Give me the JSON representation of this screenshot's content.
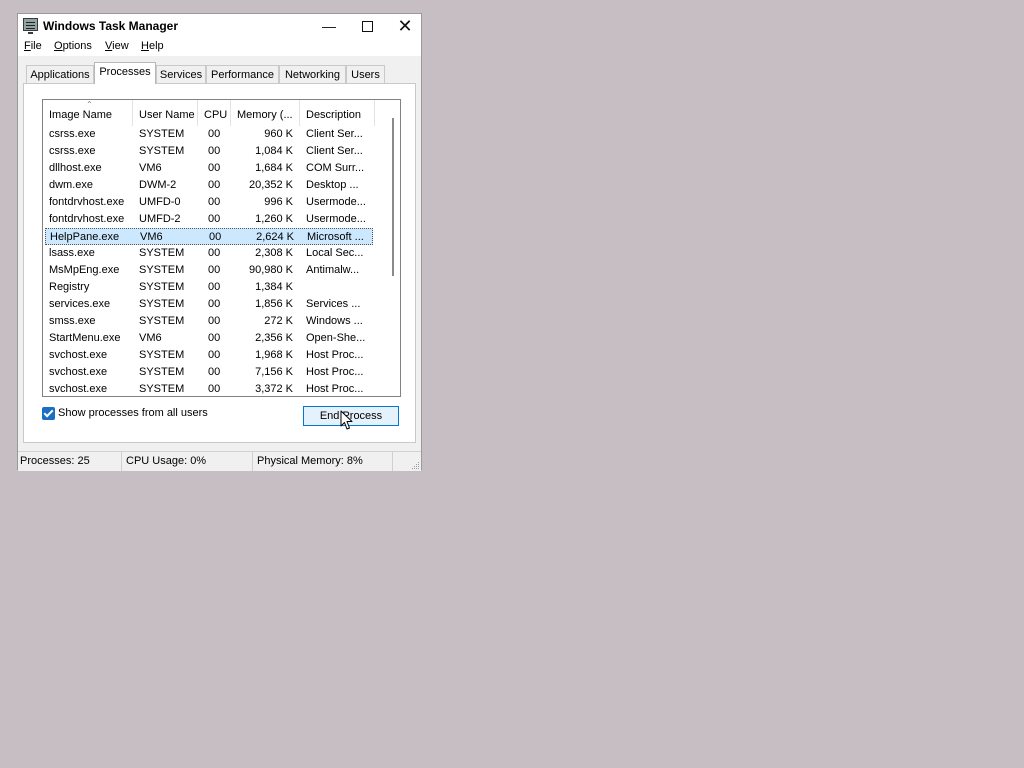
{
  "window": {
    "title": "Windows Task Manager"
  },
  "menu": [
    {
      "label": "File",
      "accel": "F",
      "rest": "ile"
    },
    {
      "label": "Options",
      "accel": "O",
      "rest": "ptions"
    },
    {
      "label": "View",
      "accel": "V",
      "rest": "iew"
    },
    {
      "label": "Help",
      "accel": "H",
      "rest": "elp"
    }
  ],
  "tabs": [
    "Applications",
    "Processes",
    "Services",
    "Performance",
    "Networking",
    "Users"
  ],
  "active_tab": "Processes",
  "columns": [
    "Image Name",
    "User Name",
    "CPU",
    "Memory (...",
    "Description"
  ],
  "rows": [
    {
      "name": "csrss.exe",
      "user": "SYSTEM",
      "cpu": "00",
      "mem": "960 K",
      "desc": "Client Ser..."
    },
    {
      "name": "csrss.exe",
      "user": "SYSTEM",
      "cpu": "00",
      "mem": "1,084 K",
      "desc": "Client Ser..."
    },
    {
      "name": "dllhost.exe",
      "user": "VM6",
      "cpu": "00",
      "mem": "1,684 K",
      "desc": "COM Surr..."
    },
    {
      "name": "dwm.exe",
      "user": "DWM-2",
      "cpu": "00",
      "mem": "20,352 K",
      "desc": "Desktop ..."
    },
    {
      "name": "fontdrvhost.exe",
      "user": "UMFD-0",
      "cpu": "00",
      "mem": "996 K",
      "desc": "Usermode..."
    },
    {
      "name": "fontdrvhost.exe",
      "user": "UMFD-2",
      "cpu": "00",
      "mem": "1,260 K",
      "desc": "Usermode..."
    },
    {
      "name": "HelpPane.exe",
      "user": "VM6",
      "cpu": "00",
      "mem": "2,624 K",
      "desc": "Microsoft ..."
    },
    {
      "name": "lsass.exe",
      "user": "SYSTEM",
      "cpu": "00",
      "mem": "2,308 K",
      "desc": "Local Sec..."
    },
    {
      "name": "MsMpEng.exe",
      "user": "SYSTEM",
      "cpu": "00",
      "mem": "90,980 K",
      "desc": "Antimalw..."
    },
    {
      "name": "Registry",
      "user": "SYSTEM",
      "cpu": "00",
      "mem": "1,384 K",
      "desc": ""
    },
    {
      "name": "services.exe",
      "user": "SYSTEM",
      "cpu": "00",
      "mem": "1,856 K",
      "desc": "Services ..."
    },
    {
      "name": "smss.exe",
      "user": "SYSTEM",
      "cpu": "00",
      "mem": "272 K",
      "desc": "Windows ..."
    },
    {
      "name": "StartMenu.exe",
      "user": "VM6",
      "cpu": "00",
      "mem": "2,356 K",
      "desc": "Open-She..."
    },
    {
      "name": "svchost.exe",
      "user": "SYSTEM",
      "cpu": "00",
      "mem": "1,968 K",
      "desc": "Host Proc..."
    },
    {
      "name": "svchost.exe",
      "user": "SYSTEM",
      "cpu": "00",
      "mem": "7,156 K",
      "desc": "Host Proc..."
    },
    {
      "name": "svchost.exe",
      "user": "SYSTEM",
      "cpu": "00",
      "mem": "3,372 K",
      "desc": "Host Proc..."
    }
  ],
  "selected_row": 6,
  "show_all": {
    "label": "Show processes from all users",
    "checked": true
  },
  "end_button": "End Process",
  "status": {
    "processes": "Processes: 25",
    "cpu": "CPU Usage: 0%",
    "memory": "Physical Memory: 8%"
  },
  "icons": {
    "app": "task-manager-icon",
    "minimize": "minimize-icon",
    "maximize": "maximize-icon",
    "close": "close-icon",
    "cursor": "mouse-pointer-icon"
  },
  "colors": {
    "desktop": "#c7bec4",
    "selection": "#cce8ff",
    "checkbox": "#1b6ec2",
    "button_border": "#0078d7"
  }
}
